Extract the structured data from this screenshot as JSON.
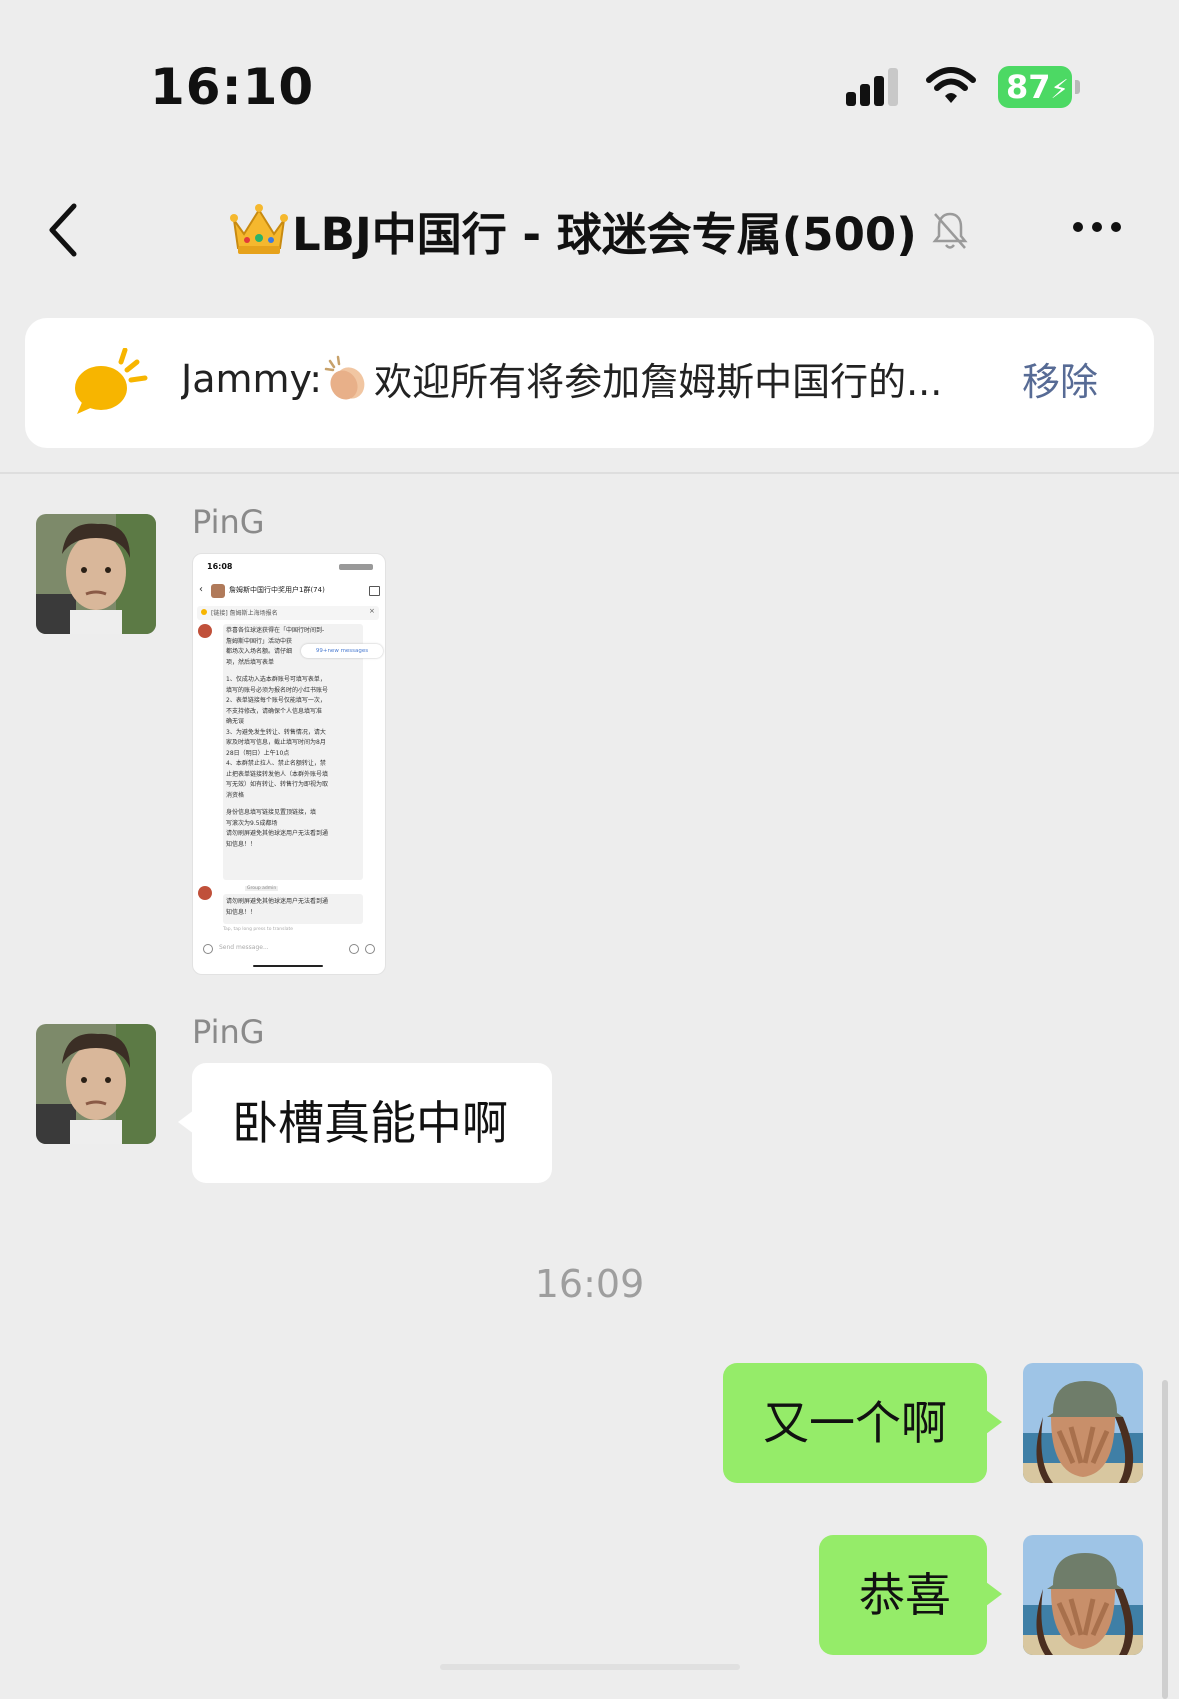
{
  "status_bar": {
    "time": "16:10",
    "battery": "87"
  },
  "header": {
    "title": "LBJ中国行 - 球迷会专属(500)"
  },
  "pinned": {
    "sender": "Jammy:",
    "text": "欢迎所有将参加詹姆斯中国行的...",
    "remove_label": "移除"
  },
  "messages": [
    {
      "sender": "PinG",
      "type": "image"
    },
    {
      "sender": "PinG",
      "type": "text",
      "text": "卧槽真能中啊"
    }
  ],
  "timestamp": "16:09",
  "my_messages": [
    {
      "text": "又一个啊"
    },
    {
      "text": "恭喜"
    }
  ],
  "screenshot_thumb": {
    "time": "16:08",
    "group_title": "詹姆斯中国行中奖用户1群(74)",
    "notice": "[链接] 詹姆斯上海场报名",
    "new_messages": "99+new messages",
    "lines": [
      "恭喜各位球迷获得在「中国行时间到-",
      "詹姆斯中国行」活动中获",
      "都场次入场名额。请仔细",
      "项，然后填写表单",
      "1、仅成功入选本群账号可填写表单，",
      "填写的账号必须为报名时的小红书账号",
      "2、表单链接每个账号仅能填写一次，",
      "不支持修改，请确保个人信息填写准",
      "确无误",
      "3、为避免发生转让、转售情况，请大",
      "家及时填写信息，截止填写时间为8月",
      "28日（明日）上午10点",
      "4、本群禁止拉人、禁止名额转让，禁",
      "止把表单链接转发他人（本群外账号填",
      "写无效）如有转让、转售行为即视为取",
      "消资格",
      "身份信息填写链接见置顶链接，填",
      "写滚次为9.5成都场",
      "请勿刷屏避免其他球迷用户无法看到通",
      "知信息！！"
    ],
    "admin_label": "Group admin",
    "reply_lines": [
      "请勿刷屏避免其他球迷用户无法看到通",
      "知信息！！"
    ],
    "hint": "Tap, tap long press to translate",
    "input_placeholder": "Send message..."
  },
  "colors": {
    "green_bubble": "#95ec69",
    "link_blue": "#576b95",
    "battery_green": "#4cd964",
    "background": "#ededed"
  }
}
